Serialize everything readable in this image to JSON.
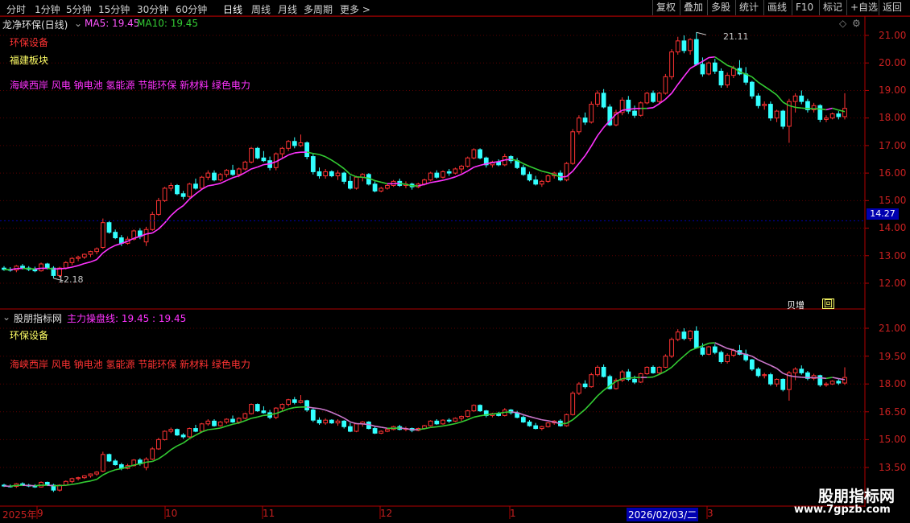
{
  "toolbar": {
    "timeframes": [
      "分时",
      "1分钟",
      "5分钟",
      "15分钟",
      "30分钟",
      "60分钟",
      "日线",
      "周线",
      "月线",
      "多周期",
      "更多 >"
    ],
    "active": "日线",
    "right_buttons": [
      "复权",
      "叠加",
      "多股",
      "统计",
      "画线",
      "F10",
      "标记",
      "+自选",
      "返回"
    ]
  },
  "main_panel": {
    "stock_name": "龙净环保(日线)",
    "ma5_label": "MA5: 19.45",
    "ma10_label": "MA10: 19.45",
    "industry": "环保设备",
    "region": "福建板块",
    "concepts": "海峡西岸 风电 钠电池 氢能源 节能环保 新材料 绿色电力",
    "price_axis": [
      "21.00",
      "20.00",
      "19.00",
      "18.00",
      "17.00",
      "16.00",
      "15.00",
      "14.00",
      "13.00",
      "12.00"
    ],
    "current_price": "14.27",
    "high_marker": "21.11",
    "low_marker": "12.18",
    "bottom_right_tag": "贝增",
    "bottom_right_icon": "回"
  },
  "indicator_panel": {
    "indicator_name": "股朋指标网",
    "line_label": "主力操盘线: 19.45 : 19.45",
    "industry": "环保设备",
    "concepts": "海峡西岸 风电 钠电池 氢能源 节能环保 新材料 绿色电力",
    "price_axis": [
      "21.00",
      "19.50",
      "18.00",
      "16.50",
      "15.00",
      "13.50"
    ]
  },
  "date_axis": {
    "labels": [
      "2025年",
      "9",
      "10",
      "11",
      "12",
      "1",
      "3"
    ],
    "cursor_date": "2026/02/03/二"
  },
  "watermark": {
    "name": "股朋指标网",
    "url": "www.7gpzb.com"
  },
  "colors": {
    "up": "#ff3333",
    "down": "#33ffff",
    "ma_up": "#ff33ff",
    "ma_down": "#33cc33",
    "ind_line": "#cc77cc"
  },
  "chart_data": {
    "type": "candlestick",
    "y_range": [
      11.7,
      21.6
    ],
    "candles": [
      [
        12.55,
        12.62,
        12.45,
        12.5
      ],
      [
        12.5,
        12.58,
        12.42,
        12.48
      ],
      [
        12.48,
        12.66,
        12.4,
        12.62
      ],
      [
        12.62,
        12.7,
        12.5,
        12.55
      ],
      [
        12.55,
        12.62,
        12.44,
        12.5
      ],
      [
        12.5,
        12.6,
        12.4,
        12.45
      ],
      [
        12.45,
        12.75,
        12.42,
        12.7
      ],
      [
        12.7,
        12.74,
        12.5,
        12.55
      ],
      [
        12.55,
        12.62,
        12.18,
        12.28
      ],
      [
        12.28,
        12.6,
        12.2,
        12.55
      ],
      [
        12.55,
        12.8,
        12.5,
        12.75
      ],
      [
        12.75,
        12.95,
        12.65,
        12.9
      ],
      [
        12.9,
        13.0,
        12.8,
        12.95
      ],
      [
        12.95,
        13.08,
        12.88,
        13.05
      ],
      [
        13.05,
        13.18,
        12.95,
        13.15
      ],
      [
        13.15,
        13.3,
        13.05,
        13.25
      ],
      [
        13.3,
        14.35,
        13.25,
        14.2
      ],
      [
        14.2,
        14.25,
        13.8,
        13.85
      ],
      [
        13.85,
        13.95,
        13.6,
        13.65
      ],
      [
        13.65,
        13.75,
        13.35,
        13.45
      ],
      [
        13.45,
        13.7,
        13.4,
        13.6
      ],
      [
        13.6,
        13.95,
        13.55,
        13.9
      ],
      [
        13.9,
        14.0,
        13.6,
        13.7
      ],
      [
        13.5,
        14.05,
        13.35,
        13.95
      ],
      [
        13.95,
        14.6,
        13.9,
        14.5
      ],
      [
        14.5,
        15.1,
        14.45,
        15.0
      ],
      [
        15.0,
        15.5,
        14.95,
        15.45
      ],
      [
        15.45,
        15.65,
        15.35,
        15.55
      ],
      [
        15.55,
        15.6,
        15.2,
        15.25
      ],
      [
        15.25,
        15.35,
        15.05,
        15.15
      ],
      [
        15.15,
        15.65,
        15.1,
        15.6
      ],
      [
        15.6,
        15.8,
        15.4,
        15.45
      ],
      [
        15.45,
        15.9,
        15.4,
        15.85
      ],
      [
        15.85,
        16.1,
        15.75,
        16.0
      ],
      [
        16.0,
        16.1,
        15.7,
        15.75
      ],
      [
        15.75,
        16.0,
        15.7,
        15.95
      ],
      [
        15.95,
        16.15,
        15.85,
        16.1
      ],
      [
        16.1,
        16.3,
        15.9,
        15.95
      ],
      [
        15.95,
        16.2,
        15.85,
        16.15
      ],
      [
        16.15,
        16.45,
        16.1,
        16.4
      ],
      [
        16.4,
        16.95,
        16.35,
        16.9
      ],
      [
        16.9,
        16.95,
        16.5,
        16.55
      ],
      [
        16.55,
        16.8,
        16.4,
        16.45
      ],
      [
        16.45,
        16.6,
        16.1,
        16.2
      ],
      [
        16.2,
        16.75,
        16.1,
        16.7
      ],
      [
        16.7,
        16.95,
        16.55,
        16.9
      ],
      [
        16.9,
        17.2,
        16.8,
        17.15
      ],
      [
        17.15,
        17.3,
        16.9,
        17.0
      ],
      [
        17.0,
        17.4,
        16.95,
        17.1
      ],
      [
        17.1,
        17.15,
        16.5,
        16.6
      ],
      [
        16.6,
        16.7,
        15.95,
        16.05
      ],
      [
        16.05,
        16.2,
        15.8,
        15.9
      ],
      [
        15.9,
        16.15,
        15.8,
        16.05
      ],
      [
        16.05,
        16.1,
        15.85,
        15.9
      ],
      [
        15.9,
        16.1,
        15.75,
        16.0
      ],
      [
        16.0,
        16.05,
        15.6,
        15.7
      ],
      [
        15.7,
        15.9,
        15.4,
        15.45
      ],
      [
        15.45,
        15.9,
        15.4,
        15.85
      ],
      [
        15.85,
        16.0,
        15.7,
        15.95
      ],
      [
        15.95,
        16.0,
        15.55,
        15.6
      ],
      [
        15.6,
        15.7,
        15.3,
        15.35
      ],
      [
        15.35,
        15.5,
        15.3,
        15.45
      ],
      [
        15.45,
        15.6,
        15.4,
        15.55
      ],
      [
        15.55,
        15.75,
        15.5,
        15.7
      ],
      [
        15.7,
        15.8,
        15.5,
        15.55
      ],
      [
        15.55,
        15.7,
        15.45,
        15.6
      ],
      [
        15.6,
        15.65,
        15.4,
        15.5
      ],
      [
        15.5,
        15.65,
        15.45,
        15.6
      ],
      [
        15.6,
        15.8,
        15.55,
        15.75
      ],
      [
        15.75,
        16.05,
        15.7,
        16.0
      ],
      [
        16.0,
        16.1,
        15.8,
        15.85
      ],
      [
        15.85,
        16.1,
        15.8,
        16.05
      ],
      [
        16.05,
        16.15,
        15.9,
        16.0
      ],
      [
        16.0,
        16.2,
        15.95,
        16.15
      ],
      [
        16.15,
        16.3,
        16.0,
        16.25
      ],
      [
        16.25,
        16.6,
        16.2,
        16.55
      ],
      [
        16.55,
        16.9,
        16.5,
        16.85
      ],
      [
        16.85,
        16.9,
        16.5,
        16.55
      ],
      [
        16.55,
        16.6,
        16.2,
        16.3
      ],
      [
        16.3,
        16.45,
        16.2,
        16.4
      ],
      [
        16.4,
        16.5,
        16.25,
        16.3
      ],
      [
        16.3,
        16.7,
        16.25,
        16.6
      ],
      [
        16.6,
        16.65,
        16.35,
        16.45
      ],
      [
        16.45,
        16.55,
        16.15,
        16.2
      ],
      [
        16.2,
        16.3,
        15.9,
        15.95
      ],
      [
        15.95,
        16.05,
        15.7,
        15.75
      ],
      [
        15.75,
        15.9,
        15.55,
        15.6
      ],
      [
        15.6,
        15.75,
        15.5,
        15.7
      ],
      [
        15.7,
        15.95,
        15.65,
        15.9
      ],
      [
        15.9,
        16.05,
        15.8,
        16.0
      ],
      [
        16.0,
        16.1,
        15.7,
        15.75
      ],
      [
        15.75,
        16.4,
        15.7,
        16.35
      ],
      [
        16.35,
        17.6,
        16.3,
        17.5
      ],
      [
        17.5,
        18.1,
        17.4,
        18.0
      ],
      [
        18.0,
        18.2,
        17.75,
        17.85
      ],
      [
        17.85,
        18.6,
        17.8,
        18.5
      ],
      [
        18.5,
        19.0,
        18.4,
        18.9
      ],
      [
        18.9,
        19.05,
        18.35,
        18.4
      ],
      [
        18.4,
        18.5,
        17.7,
        17.75
      ],
      [
        17.75,
        18.3,
        17.7,
        18.2
      ],
      [
        18.2,
        18.75,
        18.1,
        18.65
      ],
      [
        18.65,
        18.8,
        18.15,
        18.25
      ],
      [
        18.25,
        18.45,
        18.0,
        18.1
      ],
      [
        18.1,
        18.6,
        18.05,
        18.55
      ],
      [
        18.55,
        18.95,
        18.5,
        18.9
      ],
      [
        18.9,
        19.0,
        18.55,
        18.6
      ],
      [
        18.6,
        18.95,
        18.5,
        18.9
      ],
      [
        18.9,
        19.6,
        18.85,
        19.5
      ],
      [
        19.5,
        20.5,
        19.4,
        20.4
      ],
      [
        20.4,
        20.95,
        20.3,
        20.8
      ],
      [
        20.8,
        21.0,
        20.35,
        20.45
      ],
      [
        20.45,
        20.9,
        20.3,
        20.85
      ],
      [
        20.85,
        21.11,
        19.9,
        19.95
      ],
      [
        19.95,
        20.2,
        19.5,
        19.6
      ],
      [
        19.6,
        20.05,
        19.55,
        20.0
      ],
      [
        20.0,
        20.15,
        19.6,
        19.7
      ],
      [
        19.7,
        19.8,
        19.1,
        19.2
      ],
      [
        19.2,
        19.65,
        19.1,
        19.55
      ],
      [
        19.55,
        19.9,
        19.45,
        19.8
      ],
      [
        19.8,
        20.1,
        19.55,
        19.6
      ],
      [
        19.6,
        19.85,
        19.2,
        19.3
      ],
      [
        19.3,
        19.35,
        18.7,
        18.8
      ],
      [
        18.8,
        18.9,
        18.35,
        18.45
      ],
      [
        18.45,
        18.6,
        18.3,
        18.5
      ],
      [
        18.5,
        18.6,
        17.9,
        18.0
      ],
      [
        18.0,
        18.3,
        17.85,
        18.25
      ],
      [
        18.25,
        18.3,
        17.6,
        17.7
      ],
      [
        17.7,
        18.7,
        17.1,
        18.6
      ],
      [
        18.6,
        18.9,
        18.2,
        18.8
      ],
      [
        18.8,
        19.0,
        18.5,
        18.6
      ],
      [
        18.6,
        18.7,
        18.2,
        18.3
      ],
      [
        18.3,
        18.55,
        18.2,
        18.45
      ],
      [
        18.45,
        18.5,
        17.85,
        17.95
      ],
      [
        17.95,
        18.1,
        17.85,
        18.0
      ],
      [
        18.0,
        18.2,
        17.95,
        18.15
      ],
      [
        18.15,
        18.25,
        17.95,
        18.05
      ],
      [
        18.05,
        18.9,
        17.95,
        18.35
      ]
    ]
  }
}
